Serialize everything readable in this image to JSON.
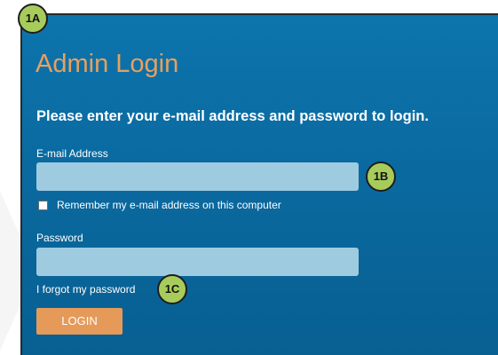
{
  "login_panel": {
    "title": "Admin Login",
    "subtitle": "Please enter your e-mail address and password to login.",
    "email_label": "E-mail Address",
    "email_value": "",
    "remember_checked": false,
    "remember_label": "Remember my e-mail address on this computer",
    "password_label": "Password",
    "password_value": "",
    "forgot_link": "I forgot my password",
    "login_button": "LOGIN"
  },
  "annotations": {
    "panel": "1A",
    "email": "1B",
    "forgot": "1C"
  },
  "colors": {
    "panel_background": "#0a6aa0",
    "title": "#e8a060",
    "input_background": "#9ecbe0",
    "button": "#e59a5a",
    "badge": "#a8cc5c"
  }
}
